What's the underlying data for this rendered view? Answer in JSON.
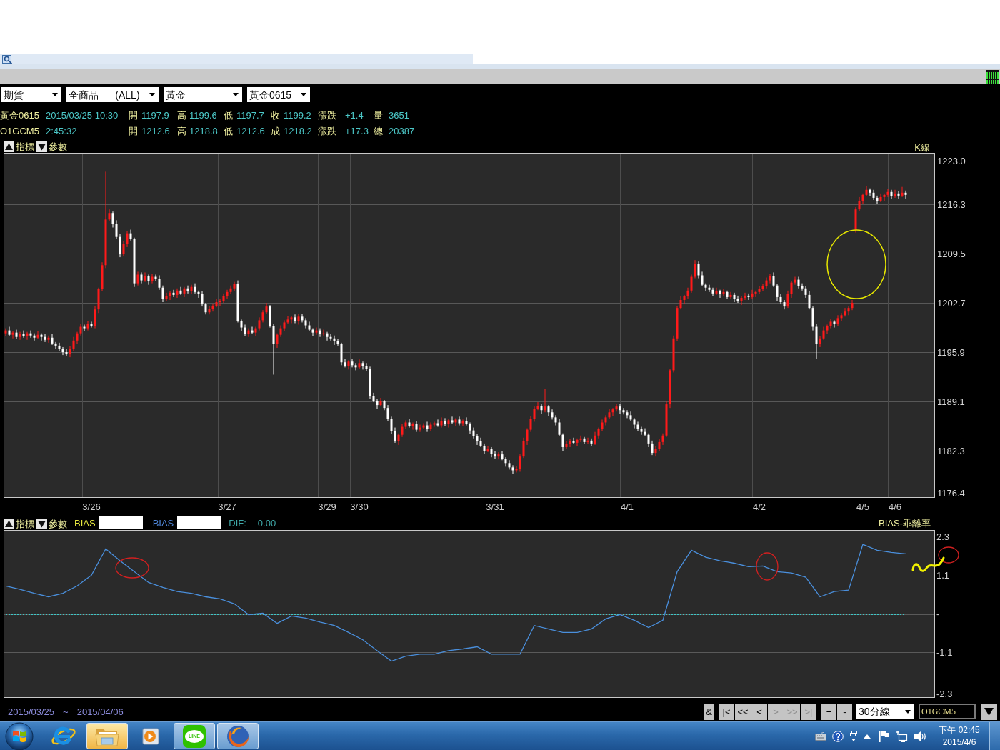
{
  "toolbar": {
    "selectors": [
      {
        "value": "期貨"
      },
      {
        "value": "全商品      (ALL)"
      },
      {
        "value": "黃金"
      },
      {
        "value": "黃金0615"
      }
    ]
  },
  "quote_rows": [
    {
      "symbol": "黃金0615",
      "time": "2015/03/25 10:30",
      "fields": [
        {
          "label": "開",
          "value": "1197.9"
        },
        {
          "label": "高",
          "value": "1199.6"
        },
        {
          "label": "低",
          "value": "1197.7"
        },
        {
          "label": "收",
          "value": "1199.2"
        },
        {
          "label": "漲跌",
          "value": "+1.4"
        },
        {
          "label": "量",
          "value": "3651"
        }
      ]
    },
    {
      "symbol": "O1GCM5",
      "time": "2:45:32",
      "fields": [
        {
          "label": "開",
          "value": "1212.6"
        },
        {
          "label": "高",
          "value": "1218.8"
        },
        {
          "label": "低",
          "value": "1212.6"
        },
        {
          "label": "成",
          "value": "1218.2"
        },
        {
          "label": "漲跌",
          "value": "+17.3"
        },
        {
          "label": "總",
          "value": "20387"
        }
      ]
    }
  ],
  "price_chart": {
    "controls": [
      {
        "kind": "up",
        "label": "指標"
      },
      {
        "kind": "down",
        "label": "參數"
      }
    ],
    "chart_data": {
      "type": "candlestick",
      "title": "K線",
      "grid": true,
      "ylim": [
        1175.8,
        1223.4
      ],
      "yticks": [
        {
          "value": 1223.0,
          "label": "1223.0"
        },
        {
          "value": 1216.3,
          "label": "1216.3"
        },
        {
          "value": 1209.5,
          "label": "1209.5"
        },
        {
          "value": 1202.7,
          "label": "1202.7"
        },
        {
          "value": 1195.9,
          "label": "1195.9"
        },
        {
          "value": 1189.1,
          "label": "1189.1"
        },
        {
          "value": 1182.3,
          "label": "1182.3"
        },
        {
          "value": 1176.4,
          "label": "1176.4"
        }
      ],
      "categories": [
        null,
        null,
        null,
        null,
        null,
        null,
        null,
        null,
        null,
        null,
        null,
        null,
        null,
        null,
        null,
        null,
        null,
        null,
        null,
        null,
        null,
        null,
        null,
        null,
        "3/26",
        null,
        null,
        null,
        null,
        null,
        null,
        null,
        null,
        null,
        null,
        null,
        null,
        null,
        null,
        null,
        null,
        null,
        null,
        null,
        null,
        null,
        null,
        null,
        null,
        null,
        null,
        null,
        null,
        null,
        null,
        null,
        null,
        null,
        null,
        null,
        null,
        null,
        "3/27",
        null,
        null,
        null,
        null,
        null,
        null,
        null,
        null,
        null,
        null,
        null,
        null,
        null,
        null,
        null,
        null,
        null,
        null,
        null,
        null,
        null,
        null,
        null,
        null,
        null,
        null,
        null,
        "3/29",
        null,
        null,
        null,
        null,
        null,
        null,
        null,
        null,
        "3/30",
        null,
        null,
        null,
        null,
        null,
        null,
        null,
        null,
        null,
        null,
        null,
        null,
        null,
        null,
        null,
        null,
        null,
        null,
        null,
        null,
        null,
        null,
        null,
        null,
        null,
        null,
        null,
        null,
        null,
        null,
        null,
        null,
        null,
        null,
        null,
        null,
        null,
        "3/31",
        null,
        null,
        null,
        null,
        null,
        null,
        null,
        null,
        null,
        null,
        null,
        null,
        null,
        null,
        null,
        null,
        null,
        null,
        null,
        null,
        null,
        null,
        null,
        null,
        null,
        null,
        null,
        null,
        null,
        null,
        null,
        null,
        null,
        null,
        null,
        null,
        "4/1",
        null,
        null,
        null,
        null,
        null,
        null,
        null,
        null,
        null,
        null,
        null,
        null,
        null,
        null,
        null,
        null,
        null,
        null,
        null,
        null,
        null,
        null,
        null,
        null,
        null,
        null,
        null,
        null,
        null,
        null,
        null,
        null,
        null,
        null,
        null,
        null,
        "4/2",
        null,
        null,
        null,
        null,
        null,
        null,
        null,
        null,
        null,
        null,
        null,
        null,
        null,
        null,
        null,
        null,
        null,
        null,
        null,
        null,
        null,
        null,
        null,
        null,
        null,
        null,
        null,
        null,
        "4/5",
        null,
        null,
        null,
        null,
        null,
        null,
        null,
        null,
        "4/6",
        null,
        null,
        null
      ],
      "ohlc": [
        [
          1198.5,
          1199.2,
          1198.1,
          1198.9
        ],
        [
          1198.9,
          1199.4,
          1198.1,
          1198.3
        ],
        [
          1198.3,
          1198.8,
          1197.8,
          1198.6
        ],
        [
          1198.6,
          1199.0,
          1197.7,
          1198.0
        ],
        [
          1198.0,
          1198.7,
          1197.6,
          1198.4
        ],
        [
          1198.4,
          1198.9,
          1197.9,
          1198.1
        ],
        [
          1198.1,
          1198.7,
          1197.6,
          1198.5
        ],
        [
          1198.5,
          1198.9,
          1197.9,
          1198.2
        ],
        [
          1198.2,
          1198.5,
          1197.5,
          1197.9
        ],
        [
          1197.9,
          1198.8,
          1197.7,
          1198.3
        ],
        [
          1198.3,
          1198.5,
          1197.5,
          1198.0
        ],
        [
          1198.0,
          1198.4,
          1197.3,
          1197.6
        ],
        [
          1197.6,
          1198.2,
          1197.2,
          1197.9
        ],
        [
          1197.9,
          1198.4,
          1196.9,
          1197.1
        ],
        [
          1197.1,
          1197.3,
          1196.3,
          1196.8
        ],
        [
          1196.8,
          1197.2,
          1196.0,
          1196.3
        ],
        [
          1196.3,
          1196.6,
          1195.5,
          1195.9
        ],
        [
          1195.9,
          1196.3,
          1195.4,
          1195.6
        ],
        [
          1195.6,
          1196.7,
          1195.2,
          1196.4
        ],
        [
          1196.4,
          1198.0,
          1196.1,
          1197.5
        ],
        [
          1197.5,
          1198.7,
          1197.0,
          1198.5
        ],
        [
          1198.5,
          1199.8,
          1198.2,
          1199.4
        ],
        [
          1199.4,
          1199.7,
          1198.8,
          1199.2
        ],
        [
          1199.2,
          1200.2,
          1198.9,
          1199.8
        ],
        [
          1199.8,
          1200.1,
          1199.3,
          1199.5
        ],
        [
          1199.5,
          1202.3,
          1199.2,
          1201.8
        ],
        [
          1201.8,
          1204.8,
          1201.3,
          1204.6
        ],
        [
          1204.6,
          1208.3,
          1204.3,
          1207.9
        ],
        [
          1207.9,
          1220.8,
          1207.5,
          1214.2
        ],
        [
          1214.2,
          1215.6,
          1214.0,
          1215.1
        ],
        [
          1215.1,
          1215.3,
          1213.1,
          1213.6
        ],
        [
          1213.6,
          1214.1,
          1211.5,
          1211.8
        ],
        [
          1211.8,
          1212.2,
          1209.0,
          1209.4
        ],
        [
          1209.4,
          1211.2,
          1209.1,
          1210.8
        ],
        [
          1210.8,
          1212.6,
          1210.4,
          1212.3
        ],
        [
          1212.3,
          1212.8,
          1211.3,
          1211.5
        ],
        [
          1211.5,
          1211.7,
          1204.9,
          1205.4
        ],
        [
          1205.4,
          1207.0,
          1205.1,
          1206.6
        ],
        [
          1206.6,
          1206.9,
          1205.4,
          1205.8
        ],
        [
          1205.8,
          1206.9,
          1205.6,
          1206.4
        ],
        [
          1206.4,
          1206.6,
          1205.2,
          1205.7
        ],
        [
          1205.7,
          1206.7,
          1205.4,
          1206.3
        ],
        [
          1206.3,
          1206.6,
          1205.7,
          1206.0
        ],
        [
          1206.0,
          1206.5,
          1204.5,
          1204.8
        ],
        [
          1204.8,
          1205.1,
          1202.8,
          1203.2
        ],
        [
          1203.2,
          1204.1,
          1203.0,
          1203.6
        ],
        [
          1203.6,
          1204.3,
          1203.1,
          1204.1
        ],
        [
          1204.1,
          1204.5,
          1203.5,
          1203.8
        ],
        [
          1203.8,
          1204.7,
          1203.4,
          1204.4
        ],
        [
          1204.4,
          1204.9,
          1203.8,
          1204.0
        ],
        [
          1204.0,
          1204.9,
          1203.5,
          1204.7
        ],
        [
          1204.7,
          1205.1,
          1204.0,
          1204.3
        ],
        [
          1204.3,
          1205.2,
          1203.9,
          1204.9
        ],
        [
          1204.9,
          1205.4,
          1204.0,
          1204.2
        ],
        [
          1204.2,
          1204.4,
          1203.4,
          1203.9
        ],
        [
          1203.9,
          1204.3,
          1202.2,
          1202.5
        ],
        [
          1202.5,
          1202.7,
          1201.1,
          1201.4
        ],
        [
          1201.4,
          1202.3,
          1201.1,
          1201.9
        ],
        [
          1201.9,
          1202.6,
          1201.5,
          1202.3
        ],
        [
          1202.3,
          1203.3,
          1202.1,
          1202.8
        ],
        [
          1202.8,
          1203.2,
          1202.3,
          1203.0
        ],
        [
          1203.0,
          1204.0,
          1202.7,
          1203.6
        ],
        [
          1203.6,
          1204.5,
          1203.3,
          1204.2
        ],
        [
          1204.2,
          1205.1,
          1203.9,
          1204.7
        ],
        [
          1204.7,
          1205.6,
          1204.3,
          1205.3
        ],
        [
          1205.3,
          1205.8,
          1200.0,
          1200.2
        ],
        [
          1200.2,
          1200.4,
          1198.8,
          1199.3
        ],
        [
          1199.3,
          1199.7,
          1198.1,
          1198.4
        ],
        [
          1198.4,
          1199.2,
          1198.0,
          1198.9
        ],
        [
          1198.9,
          1199.4,
          1198.4,
          1198.6
        ],
        [
          1198.6,
          1199.4,
          1198.1,
          1199.2
        ],
        [
          1199.2,
          1200.7,
          1198.9,
          1200.3
        ],
        [
          1200.3,
          1201.7,
          1200.0,
          1201.4
        ],
        [
          1201.4,
          1202.7,
          1201.2,
          1202.2
        ],
        [
          1202.2,
          1202.4,
          1199.3,
          1199.5
        ],
        [
          1199.5,
          1199.8,
          1192.8,
          1197.0
        ],
        [
          1197.0,
          1198.5,
          1196.5,
          1198.3
        ],
        [
          1198.3,
          1199.6,
          1198.0,
          1199.2
        ],
        [
          1199.2,
          1200.3,
          1198.8,
          1200.0
        ],
        [
          1200.0,
          1200.9,
          1199.8,
          1200.4
        ],
        [
          1200.4,
          1200.9,
          1199.9,
          1200.7
        ],
        [
          1200.7,
          1201.1,
          1199.9,
          1200.2
        ],
        [
          1200.2,
          1201.2,
          1199.7,
          1200.8
        ],
        [
          1200.8,
          1201.2,
          1200.0,
          1200.3
        ],
        [
          1200.3,
          1200.6,
          1199.2,
          1199.6
        ],
        [
          1199.6,
          1200.1,
          1198.8,
          1199.0
        ],
        [
          1199.0,
          1199.2,
          1198.1,
          1198.6
        ],
        [
          1198.6,
          1199.3,
          1198.3,
          1198.9
        ],
        [
          1198.9,
          1199.2,
          1198.0,
          1198.4
        ],
        [
          1198.4,
          1199.0,
          1198.2,
          1198.5
        ],
        [
          1198.5,
          1198.7,
          1197.5,
          1198.0
        ],
        [
          1198.0,
          1198.4,
          1197.5,
          1197.8
        ],
        [
          1197.8,
          1198.2,
          1196.9,
          1197.4
        ],
        [
          1197.4,
          1197.7,
          1196.8,
          1197.0
        ],
        [
          1197.0,
          1197.2,
          1194.1,
          1194.5
        ],
        [
          1194.5,
          1195.0,
          1193.8,
          1194.0
        ],
        [
          1194.0,
          1194.8,
          1193.5,
          1194.6
        ],
        [
          1194.6,
          1195.0,
          1193.8,
          1194.1
        ],
        [
          1194.1,
          1194.4,
          1193.4,
          1193.8
        ],
        [
          1193.8,
          1194.9,
          1193.6,
          1194.4
        ],
        [
          1194.4,
          1194.6,
          1193.5,
          1194.0
        ],
        [
          1194.0,
          1194.4,
          1193.3,
          1193.6
        ],
        [
          1193.6,
          1193.9,
          1189.4,
          1189.8
        ],
        [
          1189.8,
          1190.3,
          1189.0,
          1189.2
        ],
        [
          1189.2,
          1189.4,
          1188.1,
          1188.6
        ],
        [
          1188.6,
          1189.6,
          1188.4,
          1189.1
        ],
        [
          1189.1,
          1189.3,
          1187.9,
          1188.2
        ],
        [
          1188.2,
          1188.6,
          1186.4,
          1186.7
        ],
        [
          1186.7,
          1187.0,
          1184.6,
          1185.0
        ],
        [
          1185.0,
          1185.5,
          1183.4,
          1183.6
        ],
        [
          1183.6,
          1184.7,
          1183.1,
          1184.5
        ],
        [
          1184.5,
          1186.0,
          1184.2,
          1185.6
        ],
        [
          1185.6,
          1186.5,
          1185.3,
          1186.2
        ],
        [
          1186.2,
          1186.7,
          1185.5,
          1185.7
        ],
        [
          1185.7,
          1186.2,
          1185.2,
          1186.0
        ],
        [
          1186.0,
          1186.4,
          1184.9,
          1185.2
        ],
        [
          1185.2,
          1185.9,
          1184.9,
          1185.5
        ],
        [
          1185.5,
          1186.1,
          1185.3,
          1185.8
        ],
        [
          1185.8,
          1186.3,
          1184.9,
          1185.3
        ],
        [
          1185.3,
          1186.2,
          1185.0,
          1185.9
        ],
        [
          1185.9,
          1186.3,
          1185.6,
          1186.1
        ],
        [
          1186.1,
          1186.6,
          1185.6,
          1185.8
        ],
        [
          1185.8,
          1186.9,
          1185.5,
          1186.4
        ],
        [
          1186.4,
          1186.8,
          1185.7,
          1186.0
        ],
        [
          1186.0,
          1186.7,
          1185.5,
          1186.5
        ],
        [
          1186.5,
          1187.0,
          1186.0,
          1186.2
        ],
        [
          1186.2,
          1186.8,
          1185.7,
          1186.6
        ],
        [
          1186.6,
          1187.0,
          1185.8,
          1186.1
        ],
        [
          1186.1,
          1186.6,
          1185.7,
          1186.4
        ],
        [
          1186.4,
          1186.9,
          1185.8,
          1186.0
        ],
        [
          1186.0,
          1186.2,
          1184.6,
          1185.1
        ],
        [
          1185.1,
          1185.5,
          1184.0,
          1184.3
        ],
        [
          1184.3,
          1184.6,
          1183.1,
          1183.6
        ],
        [
          1183.6,
          1184.1,
          1182.8,
          1183.0
        ],
        [
          1183.0,
          1183.3,
          1181.9,
          1182.3
        ],
        [
          1182.3,
          1183.0,
          1182.1,
          1182.6
        ],
        [
          1182.6,
          1182.8,
          1181.4,
          1181.9
        ],
        [
          1181.9,
          1182.3,
          1181.2,
          1181.5
        ],
        [
          1181.5,
          1182.1,
          1181.1,
          1181.8
        ],
        [
          1181.8,
          1182.3,
          1181.0,
          1181.2
        ],
        [
          1181.2,
          1181.4,
          1180.1,
          1180.6
        ],
        [
          1180.6,
          1181.0,
          1179.7,
          1180.0
        ],
        [
          1180.0,
          1180.3,
          1179.1,
          1179.6
        ],
        [
          1179.6,
          1180.2,
          1179.3,
          1179.8
        ],
        [
          1179.8,
          1181.8,
          1179.4,
          1181.5
        ],
        [
          1181.5,
          1184.1,
          1181.3,
          1183.6
        ],
        [
          1183.6,
          1185.4,
          1183.1,
          1185.2
        ],
        [
          1185.2,
          1187.1,
          1184.9,
          1186.7
        ],
        [
          1186.7,
          1188.4,
          1186.3,
          1188.1
        ],
        [
          1188.1,
          1189.0,
          1187.9,
          1188.5
        ],
        [
          1188.5,
          1188.7,
          1187.4,
          1187.9
        ],
        [
          1187.9,
          1190.8,
          1187.6,
          1188.4
        ],
        [
          1188.4,
          1188.6,
          1187.1,
          1187.6
        ],
        [
          1187.6,
          1188.0,
          1186.6,
          1186.9
        ],
        [
          1186.9,
          1187.2,
          1185.8,
          1186.2
        ],
        [
          1186.2,
          1186.7,
          1184.3,
          1184.5
        ],
        [
          1184.5,
          1184.7,
          1182.3,
          1182.8
        ],
        [
          1182.8,
          1183.6,
          1182.5,
          1183.2
        ],
        [
          1183.2,
          1183.9,
          1182.8,
          1183.6
        ],
        [
          1183.6,
          1184.1,
          1183.2,
          1183.4
        ],
        [
          1183.4,
          1184.0,
          1182.9,
          1183.8
        ],
        [
          1183.8,
          1184.4,
          1183.5,
          1184.0
        ],
        [
          1184.0,
          1184.2,
          1183.2,
          1183.5
        ],
        [
          1183.5,
          1184.1,
          1183.2,
          1183.7
        ],
        [
          1183.7,
          1184.0,
          1182.9,
          1183.3
        ],
        [
          1183.3,
          1184.9,
          1183.1,
          1184.4
        ],
        [
          1184.4,
          1185.5,
          1184.0,
          1185.3
        ],
        [
          1185.3,
          1186.6,
          1185.0,
          1186.2
        ],
        [
          1186.2,
          1187.2,
          1185.8,
          1186.9
        ],
        [
          1186.9,
          1188.1,
          1186.7,
          1187.6
        ],
        [
          1187.6,
          1188.2,
          1187.1,
          1188.0
        ],
        [
          1188.0,
          1188.8,
          1187.7,
          1188.4
        ],
        [
          1188.4,
          1188.8,
          1187.4,
          1187.9
        ],
        [
          1187.9,
          1188.2,
          1187.3,
          1187.6
        ],
        [
          1187.6,
          1187.9,
          1186.8,
          1187.2
        ],
        [
          1187.2,
          1187.7,
          1186.4,
          1186.6
        ],
        [
          1186.6,
          1186.8,
          1185.4,
          1185.9
        ],
        [
          1185.9,
          1186.3,
          1185.0,
          1185.3
        ],
        [
          1185.3,
          1185.6,
          1184.5,
          1184.9
        ],
        [
          1184.9,
          1185.4,
          1184.3,
          1184.5
        ],
        [
          1184.5,
          1184.7,
          1182.8,
          1183.3
        ],
        [
          1183.3,
          1183.7,
          1181.7,
          1182.0
        ],
        [
          1182.0,
          1182.9,
          1181.5,
          1182.6
        ],
        [
          1182.6,
          1183.9,
          1182.3,
          1183.5
        ],
        [
          1183.5,
          1184.7,
          1183.1,
          1184.4
        ],
        [
          1184.4,
          1189.2,
          1184.2,
          1188.7
        ],
        [
          1188.7,
          1193.6,
          1188.2,
          1193.4
        ],
        [
          1193.4,
          1198.2,
          1193.1,
          1197.8
        ],
        [
          1197.8,
          1202.3,
          1197.4,
          1202.0
        ],
        [
          1202.0,
          1203.6,
          1201.8,
          1203.1
        ],
        [
          1203.1,
          1203.8,
          1202.6,
          1203.6
        ],
        [
          1203.6,
          1204.8,
          1203.3,
          1204.4
        ],
        [
          1204.4,
          1206.6,
          1204.1,
          1206.3
        ],
        [
          1206.3,
          1208.6,
          1206.1,
          1208.1
        ],
        [
          1208.1,
          1208.4,
          1206.1,
          1206.5
        ],
        [
          1206.5,
          1207.0,
          1205.0,
          1205.2
        ],
        [
          1205.2,
          1205.4,
          1204.3,
          1204.8
        ],
        [
          1204.8,
          1205.2,
          1204.2,
          1204.5
        ],
        [
          1204.5,
          1204.8,
          1203.6,
          1204.0
        ],
        [
          1204.0,
          1204.8,
          1203.8,
          1204.3
        ],
        [
          1204.3,
          1204.5,
          1203.4,
          1203.9
        ],
        [
          1203.9,
          1204.6,
          1203.7,
          1204.2
        ],
        [
          1204.2,
          1204.4,
          1203.2,
          1203.5
        ],
        [
          1203.5,
          1204.2,
          1203.2,
          1203.8
        ],
        [
          1203.8,
          1204.1,
          1202.8,
          1203.2
        ],
        [
          1203.2,
          1203.7,
          1202.7,
          1202.9
        ],
        [
          1202.9,
          1203.6,
          1202.4,
          1203.4
        ],
        [
          1203.4,
          1204.1,
          1203.1,
          1203.7
        ],
        [
          1203.7,
          1204.0,
          1203.1,
          1203.5
        ],
        [
          1203.5,
          1204.5,
          1203.3,
          1204.0
        ],
        [
          1204.0,
          1204.4,
          1203.5,
          1204.2
        ],
        [
          1204.2,
          1205.0,
          1203.9,
          1204.6
        ],
        [
          1204.6,
          1205.3,
          1204.3,
          1205.0
        ],
        [
          1205.0,
          1206.2,
          1204.7,
          1205.8
        ],
        [
          1205.8,
          1206.7,
          1205.4,
          1206.4
        ],
        [
          1206.4,
          1206.9,
          1204.9,
          1205.1
        ],
        [
          1205.1,
          1205.3,
          1203.0,
          1203.5
        ],
        [
          1203.5,
          1203.9,
          1202.5,
          1202.8
        ],
        [
          1202.8,
          1203.1,
          1201.8,
          1202.2
        ],
        [
          1202.2,
          1204.4,
          1202.0,
          1203.9
        ],
        [
          1203.9,
          1205.7,
          1203.4,
          1205.5
        ],
        [
          1205.5,
          1206.3,
          1205.2,
          1205.9
        ],
        [
          1205.9,
          1206.3,
          1204.7,
          1205.0
        ],
        [
          1205.0,
          1205.4,
          1204.4,
          1204.7
        ],
        [
          1204.7,
          1205.0,
          1203.4,
          1203.8
        ],
        [
          1203.8,
          1204.3,
          1201.8,
          1202.0
        ],
        [
          1202.0,
          1202.2,
          1198.9,
          1199.4
        ],
        [
          1199.4,
          1199.8,
          1195.0,
          1197.0
        ],
        [
          1197.0,
          1198.1,
          1196.6,
          1197.8
        ],
        [
          1197.8,
          1199.4,
          1197.6,
          1198.9
        ],
        [
          1198.9,
          1199.7,
          1198.4,
          1199.5
        ],
        [
          1199.5,
          1200.5,
          1199.2,
          1200.1
        ],
        [
          1200.1,
          1200.3,
          1199.3,
          1199.8
        ],
        [
          1199.8,
          1201.0,
          1199.5,
          1200.6
        ],
        [
          1200.6,
          1201.3,
          1200.2,
          1201.0
        ],
        [
          1201.0,
          1202.0,
          1200.8,
          1201.5
        ],
        [
          1201.5,
          1202.2,
          1201.0,
          1202.0
        ],
        [
          1202.0,
          1203.1,
          1201.7,
          1202.7
        ],
        [
          1212.8,
          1215.9,
          1212.4,
          1215.6
        ],
        [
          1215.6,
          1217.3,
          1215.4,
          1216.8
        ],
        [
          1216.8,
          1217.8,
          1216.3,
          1217.6
        ],
        [
          1217.6,
          1218.8,
          1217.4,
          1218.3
        ],
        [
          1218.3,
          1218.5,
          1217.4,
          1217.9
        ],
        [
          1217.9,
          1218.3,
          1216.9,
          1217.2
        ],
        [
          1217.2,
          1217.5,
          1216.4,
          1216.8
        ],
        [
          1216.8,
          1217.8,
          1216.6,
          1217.3
        ],
        [
          1217.3,
          1217.8,
          1216.8,
          1217.6
        ],
        [
          1217.6,
          1218.4,
          1217.3,
          1218.0
        ],
        [
          1218.0,
          1218.3,
          1217.0,
          1217.4
        ],
        [
          1217.4,
          1218.3,
          1217.2,
          1217.8
        ],
        [
          1217.8,
          1218.1,
          1217.1,
          1217.5
        ],
        [
          1217.5,
          1218.7,
          1217.3,
          1217.9
        ],
        [
          1217.9,
          1218.2,
          1217.1,
          1217.6
        ]
      ]
    }
  },
  "indicator_panel": {
    "controls": [
      {
        "kind": "up",
        "label": "指標"
      },
      {
        "kind": "down",
        "label": "參數"
      }
    ],
    "legend": [
      {
        "label": "BIAS",
        "color": "#e6e640"
      },
      {
        "label": "BIAS",
        "color": "#4f86d8"
      }
    ],
    "dif": {
      "label": "DIF:",
      "value": "0.00"
    },
    "chart_data": {
      "type": "line",
      "title": "BIAS-乖離率",
      "grid": true,
      "series": [
        {
          "color": "#4a8fdc",
          "values": [
            0.8,
            0.7,
            0.59,
            0.49,
            0.59,
            0.8,
            1.11,
            1.86,
            1.52,
            1.21,
            0.9,
            0.76,
            0.64,
            0.59,
            0.49,
            0.43,
            0.29,
            -0.02,
            0.02,
            -0.27,
            -0.06,
            -0.12,
            -0.23,
            -0.33,
            -0.53,
            -0.74,
            -1.05,
            -1.35,
            -1.21,
            -1.15,
            -1.15,
            -1.05,
            -1.0,
            -0.94,
            -1.15,
            -1.15,
            -1.15,
            -0.33,
            -0.43,
            -0.53,
            -0.53,
            -0.43,
            -0.14,
            -0.02,
            -0.18,
            -0.39,
            -0.18,
            1.21,
            1.82,
            1.62,
            1.52,
            1.45,
            1.35,
            1.37,
            1.21,
            1.17,
            1.05,
            0.49,
            0.64,
            0.68,
            1.99,
            1.82,
            1.76,
            1.72
          ]
        }
      ],
      "ylim": [
        -2.4,
        2.4
      ],
      "yticks": [
        {
          "value": 2.3,
          "label": "2.3"
        },
        {
          "value": 1.1,
          "label": "1.1"
        },
        {
          "value": 0,
          "label": "-"
        },
        {
          "value": -1.1,
          "label": "-1.1"
        },
        {
          "value": -2.3,
          "label": "-2.3"
        }
      ],
      "ref_lines": [
        {
          "axis": "y",
          "value": 0,
          "color": "#3cc8c8"
        }
      ]
    }
  },
  "footer": {
    "date_from": "2015/03/25",
    "separator": "~",
    "date_to": "2015/04/06",
    "link_buttons": [
      {
        "label": "&",
        "disabled": false
      }
    ],
    "nav_buttons": [
      {
        "label": "|<",
        "disabled": false
      },
      {
        "label": "<<",
        "disabled": false
      },
      {
        "label": "<",
        "disabled": false
      },
      {
        "label": ">",
        "disabled": true
      },
      {
        "label": ">>",
        "disabled": true
      },
      {
        "label": ">|",
        "disabled": true
      }
    ],
    "zoom_buttons": [
      {
        "label": "+",
        "disabled": false
      },
      {
        "label": "-",
        "disabled": false
      }
    ],
    "interval_select": {
      "value": "30分線"
    },
    "symbol_field": {
      "value": "O1GCM5"
    }
  },
  "taskbar": {
    "apps": [
      {
        "running": false,
        "highlighted": false
      },
      {
        "running": true,
        "highlighted": true
      },
      {
        "running": false,
        "highlighted": false
      },
      {
        "running": true,
        "highlighted": false,
        "logo_text": "LINE"
      },
      {
        "running": true,
        "highlighted": false
      }
    ],
    "clock": {
      "time": "下午 02:45",
      "date": "2015/4/6"
    }
  }
}
